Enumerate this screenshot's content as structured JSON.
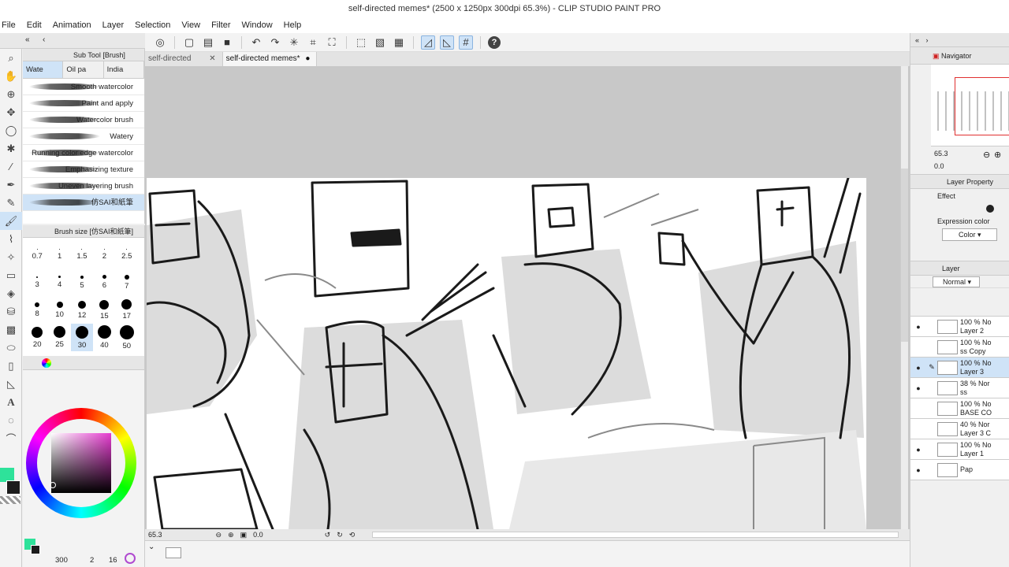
{
  "window": {
    "title": "self-directed memes* (2500 x 1250px 300dpi 65.3%)  - CLIP STUDIO PAINT PRO"
  },
  "menu": [
    "File",
    "Edit",
    "Animation",
    "Layer",
    "Selection",
    "View",
    "Filter",
    "Window",
    "Help"
  ],
  "doc_tabs": [
    {
      "label": "self-directed"
    },
    {
      "label": "self-directed memes*"
    }
  ],
  "subtool": {
    "title": "Sub Tool [Brush]",
    "tabs": [
      "Wate",
      "Oil pa",
      "India"
    ],
    "brushes": [
      "Smooth watercolor",
      "Paint and apply",
      "Watercolor brush",
      "Watery",
      "Running color edge watercolor",
      "Emphasizing texture",
      "Uneven layering brush",
      "仿SAI和紙筆"
    ]
  },
  "brush_size": {
    "title": "Brush size [仿SAI和紙筆]",
    "sizes": [
      "0.7",
      "1",
      "1.5",
      "2",
      "2.5",
      "3",
      "4",
      "5",
      "6",
      "7",
      "8",
      "10",
      "12",
      "15",
      "17",
      "20",
      "25",
      "30",
      "40",
      "50"
    ],
    "selected": "30"
  },
  "colors": {
    "main": "#2ee29a",
    "sub": "#1c1c1c",
    "accent": "#cfe3f7"
  },
  "status": {
    "zoom": "65.3",
    "angle": "0.0"
  },
  "left_bottom": {
    "value1": "300",
    "value2": "2",
    "value3": "16"
  },
  "navigator": {
    "title": "Navigator",
    "zoom": "65.3",
    "angle": "0.0"
  },
  "layer_property": {
    "title": "Layer Property",
    "effect_label": "Effect",
    "expression_label": "Expression color",
    "expression_value": "Color"
  },
  "layer_panel": {
    "title": "Layer",
    "blend_mode": "Normal",
    "layers": [
      {
        "pct": "100 % No",
        "name": "Layer 2",
        "visible": true,
        "active": false
      },
      {
        "pct": "100 % No",
        "name": "ss Copy",
        "visible": false,
        "active": false
      },
      {
        "pct": "100 % No",
        "name": "Layer 3",
        "visible": true,
        "active": true
      },
      {
        "pct": "38 % Nor",
        "name": "ss",
        "visible": true,
        "active": false
      },
      {
        "pct": "100 % No",
        "name": "BASE CO",
        "visible": false,
        "active": false
      },
      {
        "pct": "40 % Nor",
        "name": "Layer 3 C",
        "visible": false,
        "active": false
      },
      {
        "pct": "100 % No",
        "name": "Layer 1",
        "visible": true,
        "active": false
      },
      {
        "pct": "",
        "name": "Pap",
        "visible": true,
        "active": false
      }
    ]
  }
}
